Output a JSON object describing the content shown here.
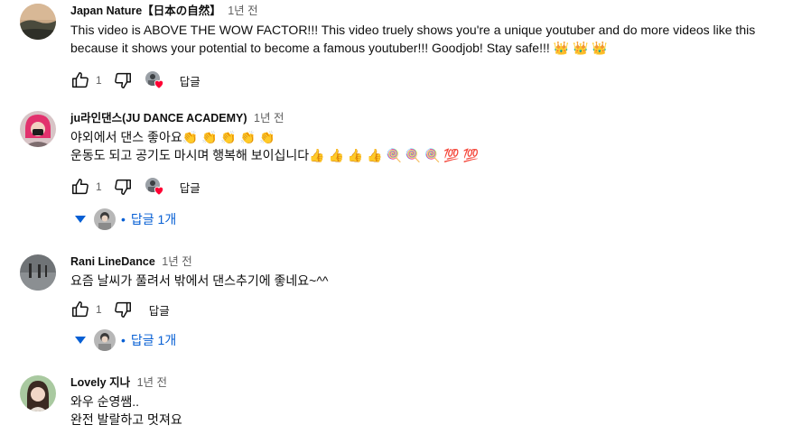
{
  "comments": [
    {
      "author": "Japan Nature【日本の自然】",
      "time": "1년 전",
      "lines": [
        "This video is ABOVE THE WOW FACTOR!!! This video truely shows you're a unique youtuber and do more videos like this",
        "because it shows your potential to become a famous youtuber!!! Goodjob! Stay safe!!! 👑 👑 👑"
      ],
      "likes": "1",
      "reply_label": "답글"
    },
    {
      "author": "ju라인댄스(JU DANCE ACADEMY)",
      "time": "1년 전",
      "lines": [
        "야외에서 댄스 좋아요👏 👏 👏 👏 👏",
        "운동도 되고 공기도 마시며 행복해 보이십니다👍 👍 👍 👍 🍭 🍭 🍭 💯 💯"
      ],
      "likes": "1",
      "reply_label": "답글",
      "replies_label": "답글 1개"
    },
    {
      "author": "Rani LineDance",
      "time": "1년 전",
      "lines": [
        "요즘 날씨가 풀려서 밖에서 댄스추기에 좋네요~^^"
      ],
      "likes": "1",
      "reply_label": "답글",
      "replies_label": "답글 1개"
    },
    {
      "author": "Lovely 지나",
      "time": "1년 전",
      "lines": [
        "와우 순영쌤..",
        "완전 발랄하고 멋져요"
      ]
    }
  ],
  "colors": {
    "link_blue": "#065fd4",
    "heart_red": "#ff0033",
    "secondary_text": "#606060"
  },
  "icons": {
    "like": "thumbs-up-icon",
    "dislike": "thumbs-down-icon",
    "heart": "creator-heart-icon",
    "expand": "caret-down-icon"
  }
}
